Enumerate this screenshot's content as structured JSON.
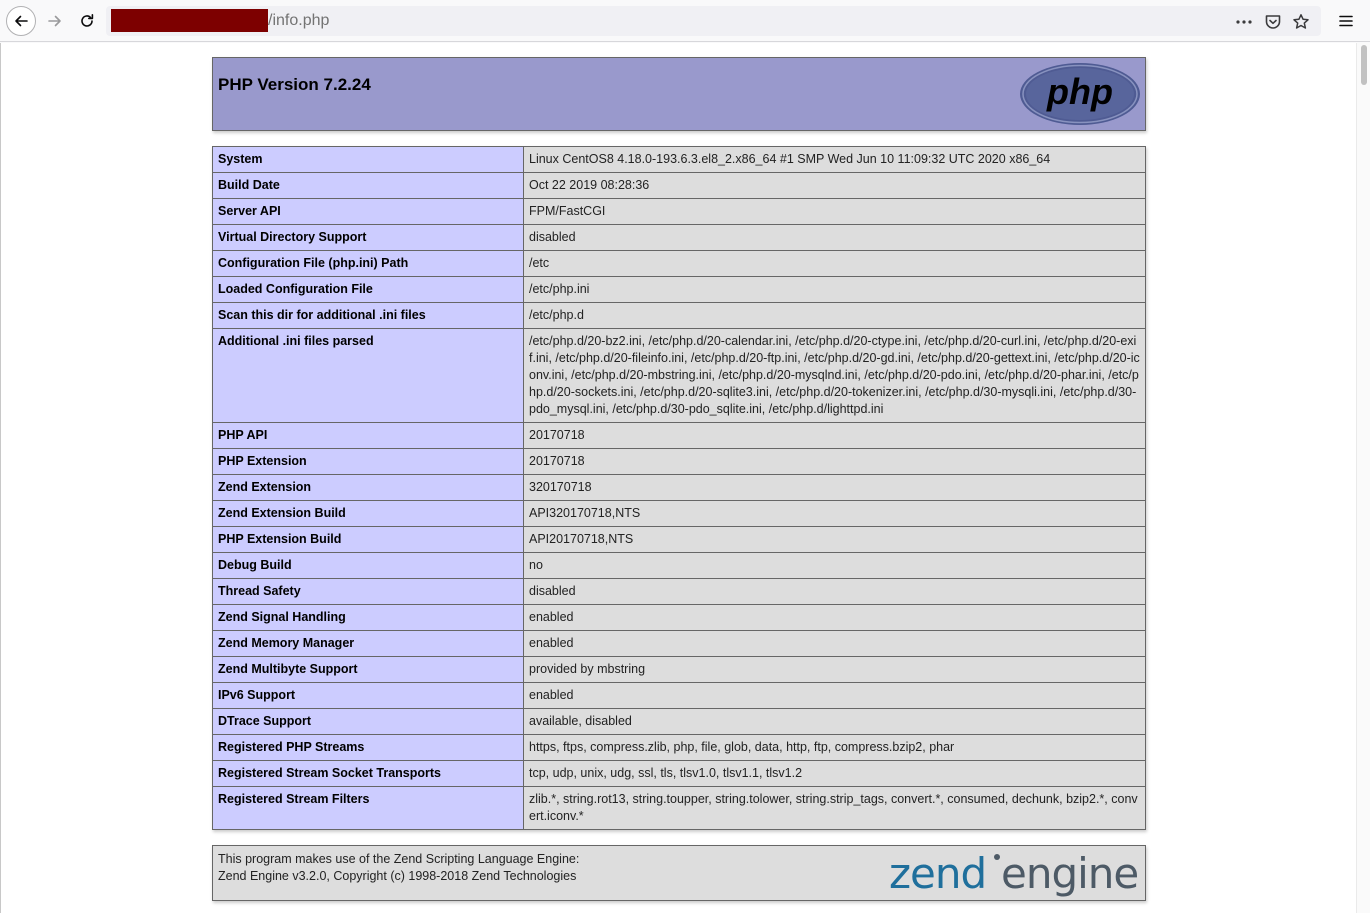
{
  "browser": {
    "url_path": "/info.php"
  },
  "header": {
    "title": "PHP Version 7.2.24",
    "logo_text": "php"
  },
  "rows": [
    {
      "key": "System",
      "value": "Linux CentOS8 4.18.0-193.6.3.el8_2.x86_64 #1 SMP Wed Jun 10 11:09:32 UTC 2020 x86_64"
    },
    {
      "key": "Build Date",
      "value": "Oct 22 2019 08:28:36"
    },
    {
      "key": "Server API",
      "value": "FPM/FastCGI"
    },
    {
      "key": "Virtual Directory Support",
      "value": "disabled"
    },
    {
      "key": "Configuration File (php.ini) Path",
      "value": "/etc"
    },
    {
      "key": "Loaded Configuration File",
      "value": "/etc/php.ini"
    },
    {
      "key": "Scan this dir for additional .ini files",
      "value": "/etc/php.d"
    },
    {
      "key": "Additional .ini files parsed",
      "value": "/etc/php.d/20-bz2.ini, /etc/php.d/20-calendar.ini, /etc/php.d/20-ctype.ini, /etc/php.d/20-curl.ini, /etc/php.d/20-exif.ini, /etc/php.d/20-fileinfo.ini, /etc/php.d/20-ftp.ini, /etc/php.d/20-gd.ini, /etc/php.d/20-gettext.ini, /etc/php.d/20-iconv.ini, /etc/php.d/20-mbstring.ini, /etc/php.d/20-mysqlnd.ini, /etc/php.d/20-pdo.ini, /etc/php.d/20-phar.ini, /etc/php.d/20-sockets.ini, /etc/php.d/20-sqlite3.ini, /etc/php.d/20-tokenizer.ini, /etc/php.d/30-mysqli.ini, /etc/php.d/30-pdo_mysql.ini, /etc/php.d/30-pdo_sqlite.ini, /etc/php.d/lighttpd.ini"
    },
    {
      "key": "PHP API",
      "value": "20170718"
    },
    {
      "key": "PHP Extension",
      "value": "20170718"
    },
    {
      "key": "Zend Extension",
      "value": "320170718"
    },
    {
      "key": "Zend Extension Build",
      "value": "API320170718,NTS"
    },
    {
      "key": "PHP Extension Build",
      "value": "API20170718,NTS"
    },
    {
      "key": "Debug Build",
      "value": "no"
    },
    {
      "key": "Thread Safety",
      "value": "disabled"
    },
    {
      "key": "Zend Signal Handling",
      "value": "enabled"
    },
    {
      "key": "Zend Memory Manager",
      "value": "enabled"
    },
    {
      "key": "Zend Multibyte Support",
      "value": "provided by mbstring"
    },
    {
      "key": "IPv6 Support",
      "value": "enabled"
    },
    {
      "key": "DTrace Support",
      "value": "available, disabled"
    },
    {
      "key": "Registered PHP Streams",
      "value": "https, ftps, compress.zlib, php, file, glob, data, http, ftp, compress.bzip2, phar"
    },
    {
      "key": "Registered Stream Socket Transports",
      "value": "tcp, udp, unix, udg, ssl, tls, tlsv1.0, tlsv1.1, tlsv1.2"
    },
    {
      "key": "Registered Stream Filters",
      "value": "zlib.*, string.rot13, string.toupper, string.tolower, string.strip_tags, convert.*, consumed, dechunk, bzip2.*, convert.iconv.*"
    }
  ],
  "zend": {
    "line1": "This program makes use of the Zend Scripting Language Engine:",
    "line2": "Zend Engine v3.2.0, Copyright (c) 1998-2018 Zend Technologies",
    "logo_zend": "zend",
    "logo_engine": "engine"
  },
  "colors": {
    "header_bg": "#9999cc",
    "key_bg": "#ccccff",
    "value_bg": "#dddddd",
    "zend_blue": "#1f6f9c",
    "zend_gray": "#4d5a66",
    "redaction": "#7d0000"
  },
  "icons": [
    "back-arrow-icon",
    "forward-arrow-icon",
    "reload-icon",
    "more-dots-icon",
    "pocket-icon",
    "bookmark-star-icon",
    "hamburger-menu-icon"
  ]
}
